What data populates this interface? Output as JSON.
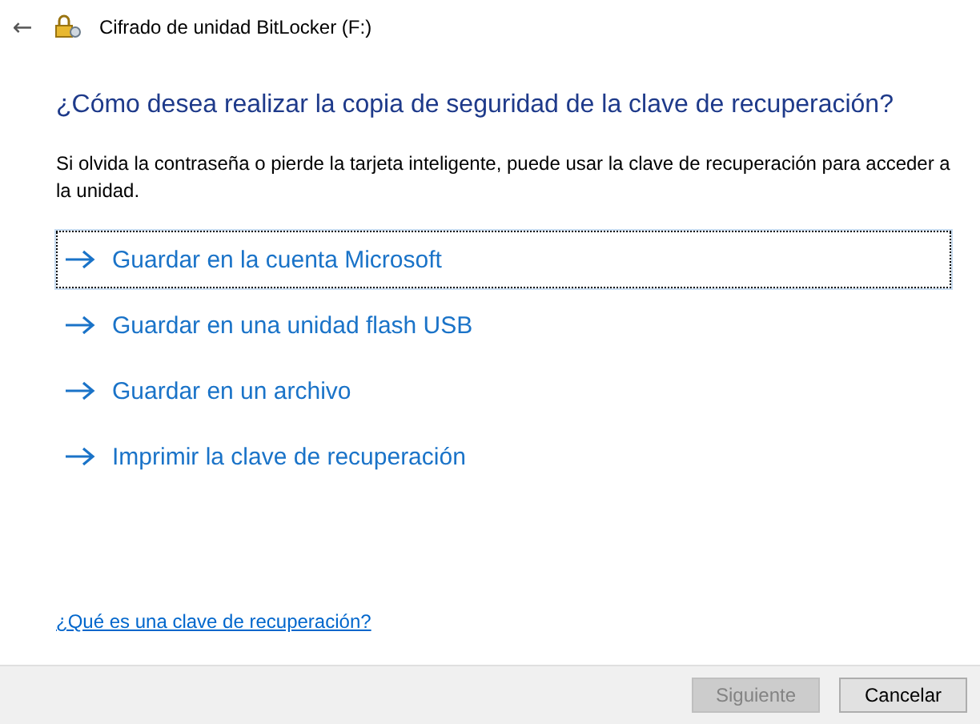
{
  "window": {
    "back_button": "←",
    "title": "Cifrado de unidad BitLocker (F:)"
  },
  "heading": "¿Cómo desea realizar la copia de seguridad de la clave de recuperación?",
  "description": "Si olvida la contraseña o pierde la tarjeta inteligente, puede usar la clave de recuperación para acceder a la unidad.",
  "options": [
    {
      "label": "Guardar en la cuenta Microsoft",
      "selected": true
    },
    {
      "label": "Guardar en una unidad flash USB",
      "selected": false
    },
    {
      "label": "Guardar en un archivo",
      "selected": false
    },
    {
      "label": "Imprimir la clave de recuperación",
      "selected": false
    }
  ],
  "help_link": "¿Qué es una clave de recuperación?",
  "buttons": [
    {
      "label": "Siguiente",
      "disabled": true
    },
    {
      "label": "Cancelar",
      "disabled": false
    }
  ]
}
